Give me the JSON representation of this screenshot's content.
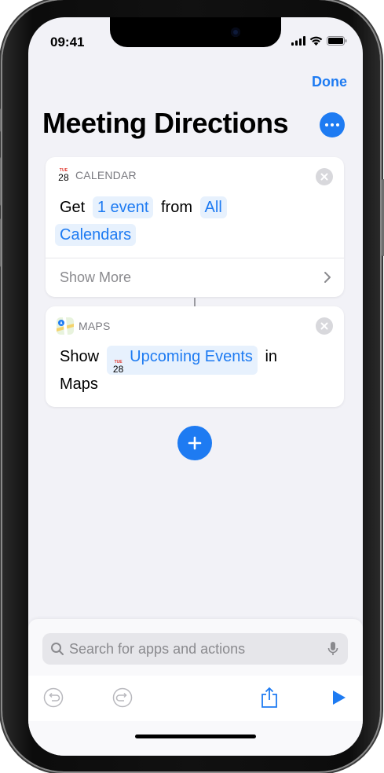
{
  "status_bar": {
    "time": "09:41"
  },
  "nav": {
    "done_label": "Done"
  },
  "page": {
    "title": "Meeting Directions"
  },
  "actions": [
    {
      "app": "CALENDAR",
      "app_icon": "calendar-icon",
      "verb": "Get",
      "token_1": "1 event",
      "joiner": "from",
      "token_2_line1": "All",
      "token_2_line2": "Calendars",
      "show_more": "Show More",
      "icon_month": "TUE",
      "icon_day": "28"
    },
    {
      "app": "MAPS",
      "app_icon": "maps-icon",
      "verb": "Show",
      "token_1": "Upcoming Events",
      "joiner": "in",
      "line2": "Maps",
      "icon_month": "TUE",
      "icon_day": "28"
    }
  ],
  "search": {
    "placeholder": "Search for apps and actions",
    "value": ""
  },
  "toolbar": {
    "icons": [
      "undo-icon",
      "redo-icon",
      "share-icon",
      "play-icon"
    ]
  },
  "colors": {
    "accent": "#1e7bf2",
    "token_bg": "#e7f1fd",
    "background": "#f2f2f7"
  }
}
